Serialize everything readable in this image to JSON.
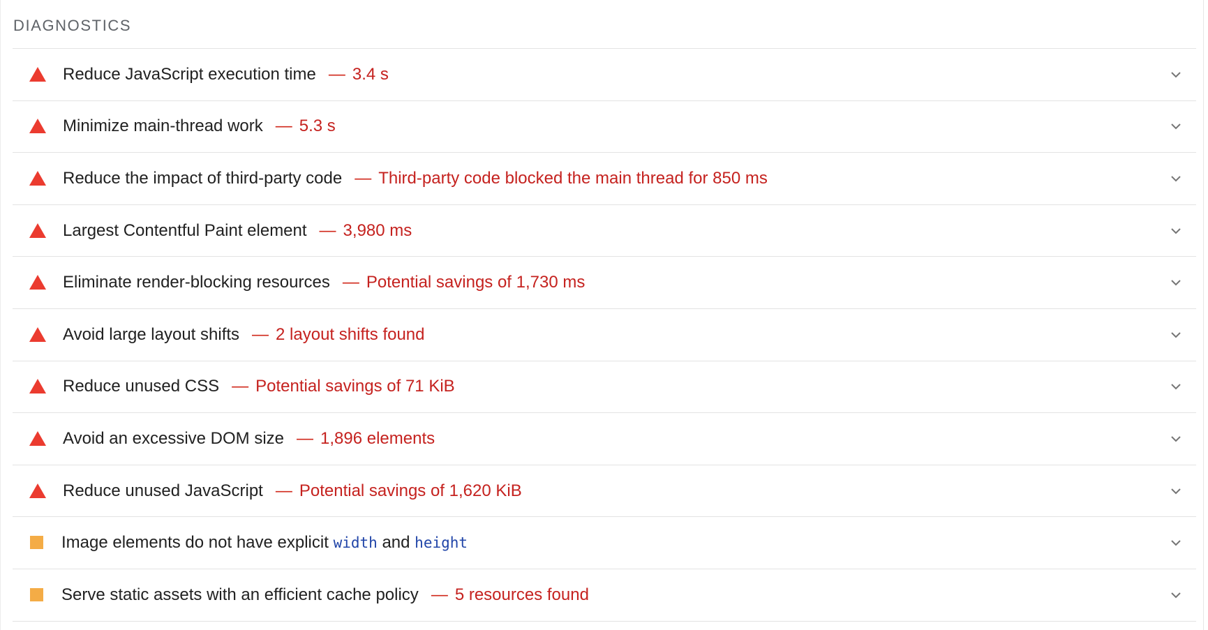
{
  "section": {
    "title": "DIAGNOSTICS"
  },
  "audits": [
    {
      "status": "fail",
      "title": "Reduce JavaScript execution time",
      "separator": "—",
      "display": "3.4 s"
    },
    {
      "status": "fail",
      "title": "Minimize main-thread work",
      "separator": "—",
      "display": "5.3 s"
    },
    {
      "status": "fail",
      "title": "Reduce the impact of third-party code",
      "separator": "—",
      "display": "Third-party code blocked the main thread for 850 ms"
    },
    {
      "status": "fail",
      "title": "Largest Contentful Paint element",
      "separator": "—",
      "display": "3,980 ms"
    },
    {
      "status": "fail",
      "title": "Eliminate render-blocking resources",
      "separator": "—",
      "display": "Potential savings of 1,730 ms"
    },
    {
      "status": "fail",
      "title": "Avoid large layout shifts",
      "separator": "—",
      "display": "2 layout shifts found"
    },
    {
      "status": "fail",
      "title": "Reduce unused CSS",
      "separator": "—",
      "display": "Potential savings of 71 KiB"
    },
    {
      "status": "fail",
      "title": "Avoid an excessive DOM size",
      "separator": "—",
      "display": "1,896 elements"
    },
    {
      "status": "fail",
      "title": "Reduce unused JavaScript",
      "separator": "—",
      "display": "Potential savings of 1,620 KiB"
    },
    {
      "status": "average",
      "title_parts": [
        "Image elements do not have explicit ",
        "width",
        " and ",
        "height"
      ]
    },
    {
      "status": "average",
      "title": "Serve static assets with an efficient cache policy",
      "separator": "—",
      "display": "5 resources found"
    }
  ],
  "icons": {
    "fail": "triangle-fail-icon",
    "average": "square-average-icon",
    "expand": "chevron-down-icon"
  },
  "colors": {
    "fail": "#eb3b2f",
    "fail_text": "#c5221f",
    "average": "#f4ac46",
    "code": "#2145a8"
  }
}
